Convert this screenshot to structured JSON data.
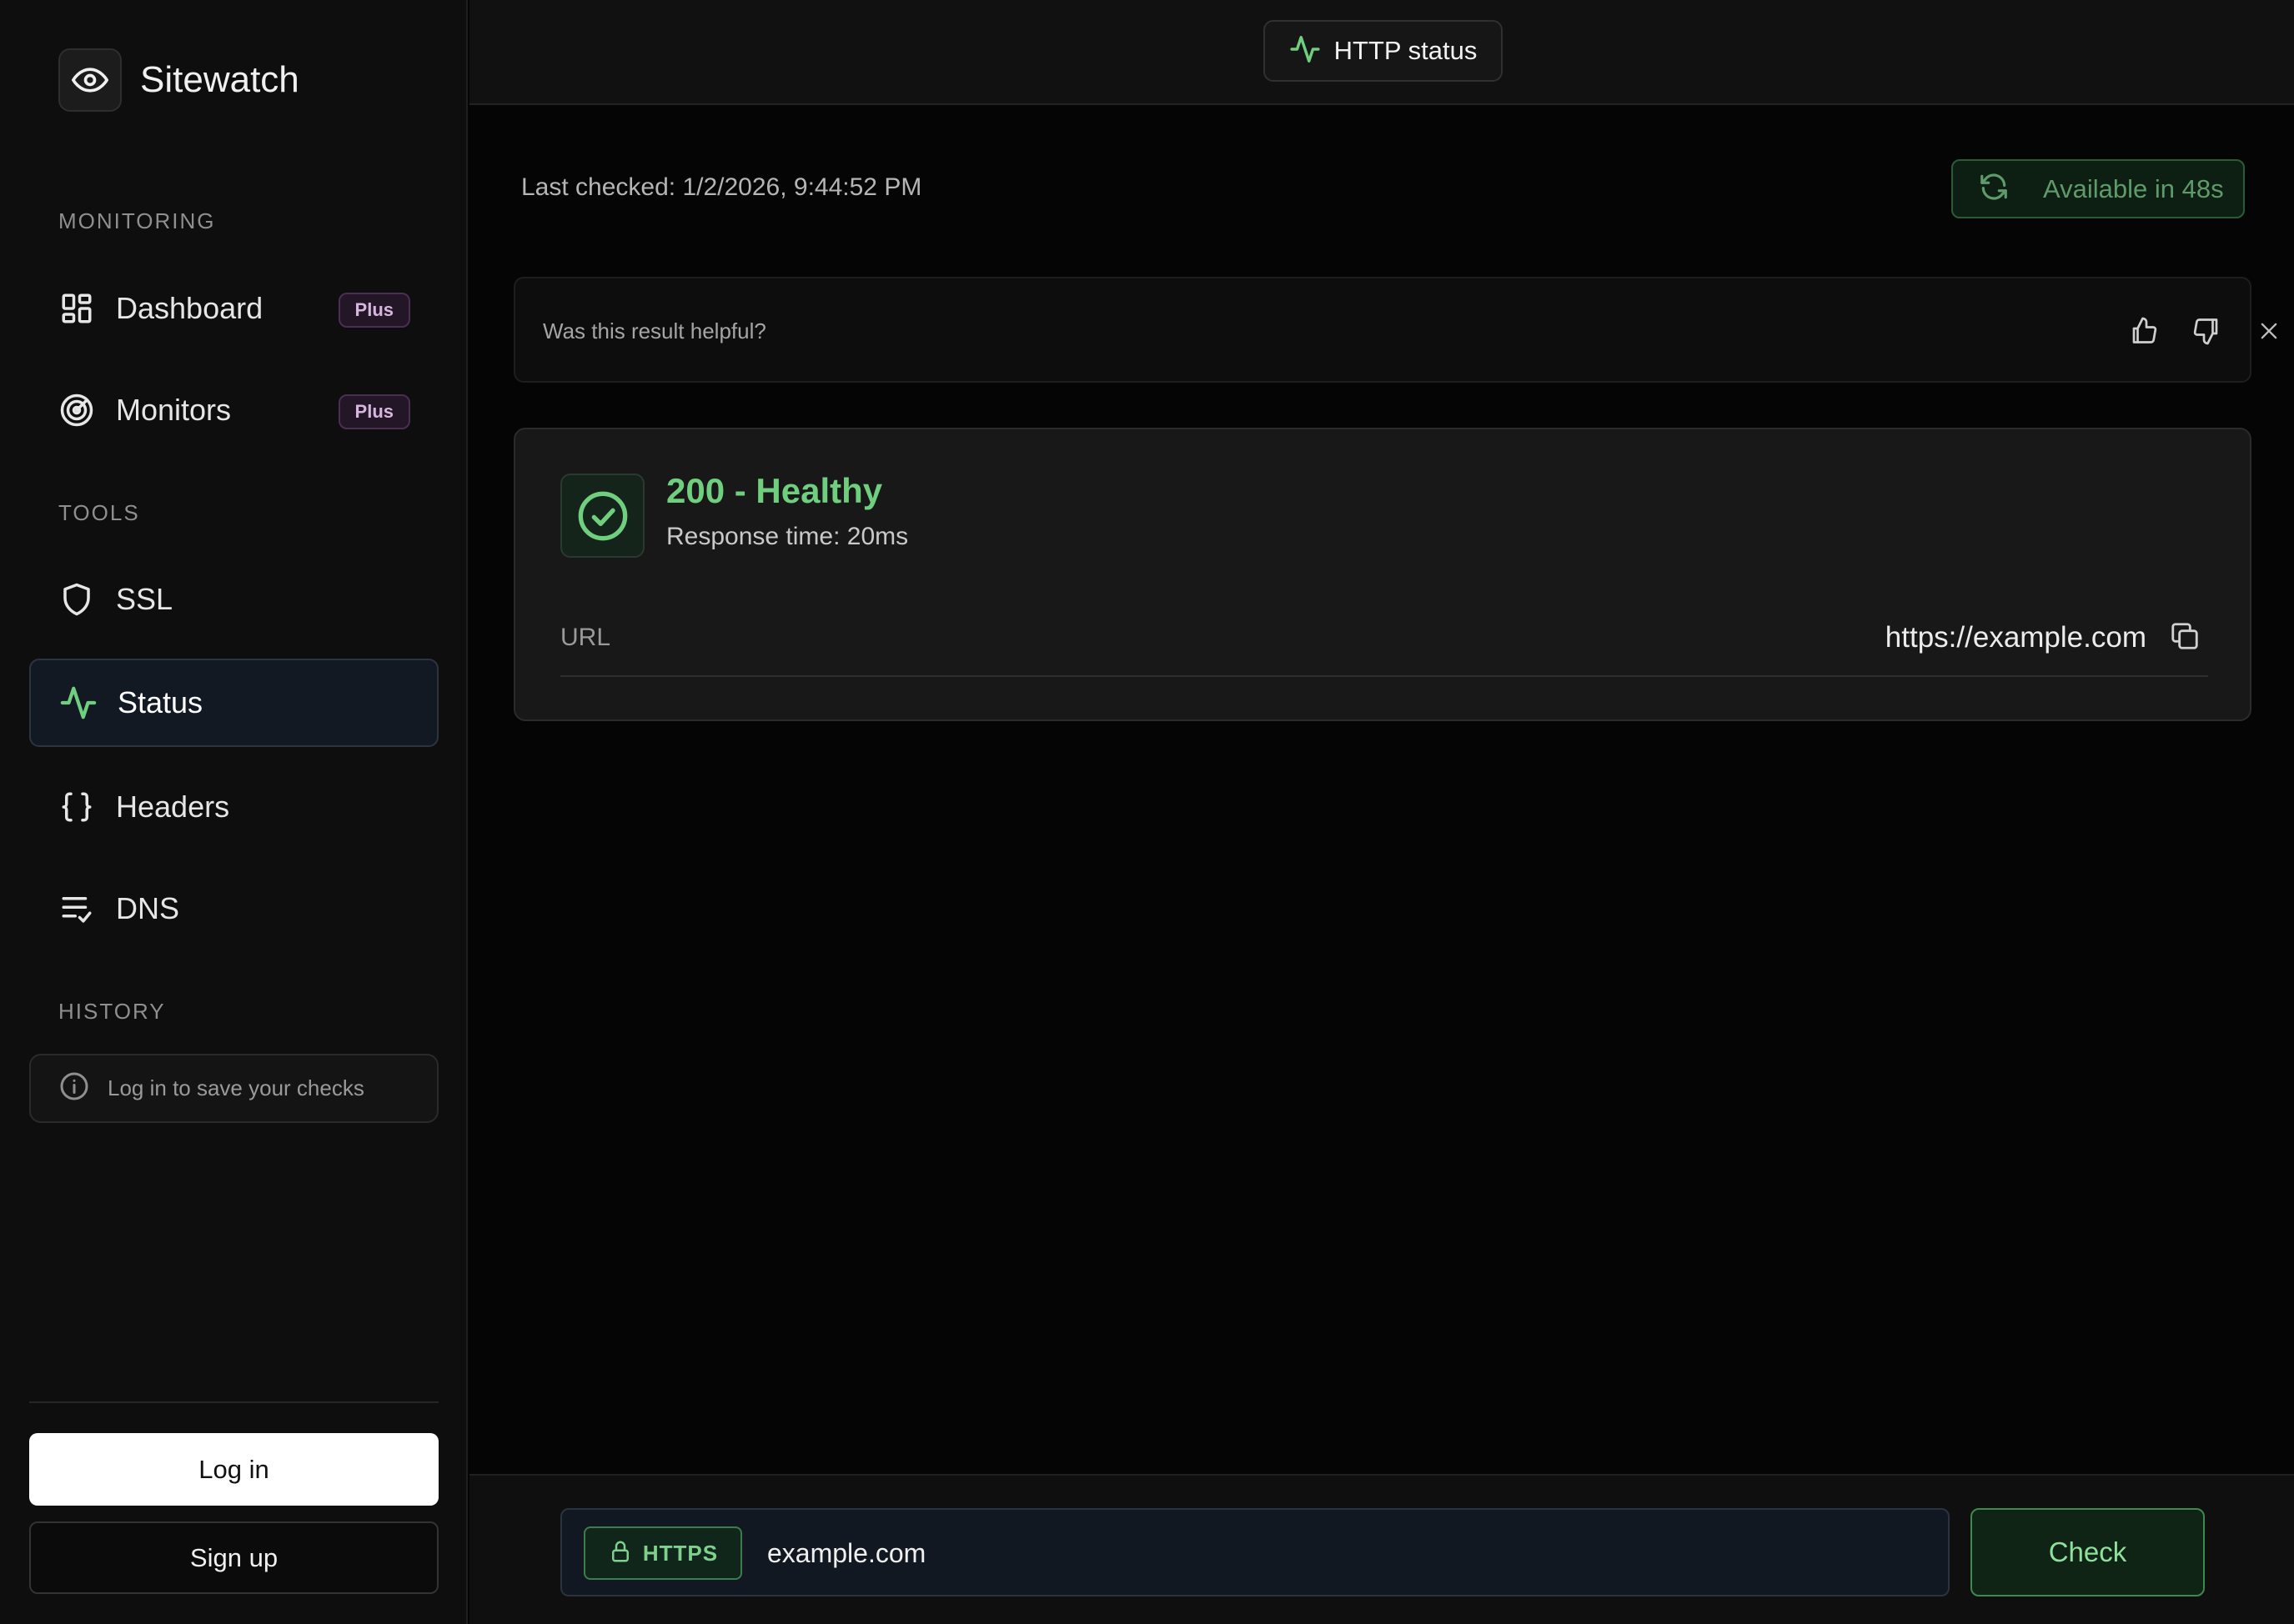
{
  "brand": {
    "name": "Sitewatch",
    "icon": "eye-icon"
  },
  "sidebar": {
    "sections": {
      "monitoring": "MONITORING",
      "tools": "TOOLS",
      "history": "HISTORY"
    },
    "items": [
      {
        "label": "Dashboard",
        "icon": "dashboard-icon",
        "badge": "Plus",
        "active": false
      },
      {
        "label": "Monitors",
        "icon": "radar-icon",
        "badge": "Plus",
        "active": false
      },
      {
        "label": "SSL",
        "icon": "shield-icon",
        "active": false
      },
      {
        "label": "Status",
        "icon": "activity-icon",
        "active": true
      },
      {
        "label": "Headers",
        "icon": "braces-icon",
        "active": false
      },
      {
        "label": "DNS",
        "icon": "list-check-icon",
        "active": false
      }
    ],
    "history_note": "Log in to save your checks",
    "login_label": "Log in",
    "signup_label": "Sign up"
  },
  "header": {
    "title": "HTTP status",
    "icon": "activity-icon"
  },
  "main": {
    "last_checked": "Last checked: 1/2/2026, 9:44:52 PM",
    "refresh_label": "Available in 48s",
    "feedback_question": "Was this result helpful?",
    "result": {
      "status_title": "200 - Healthy",
      "response_time": "Response time: 20ms",
      "url_label": "URL",
      "url_value": "https://example.com"
    }
  },
  "input": {
    "protocol": "HTTPS",
    "value": "example.com",
    "check_label": "Check"
  },
  "colors": {
    "accent_green": "#6fcf7f",
    "badge_purple": "#d6b6e0",
    "background": "#050505"
  }
}
